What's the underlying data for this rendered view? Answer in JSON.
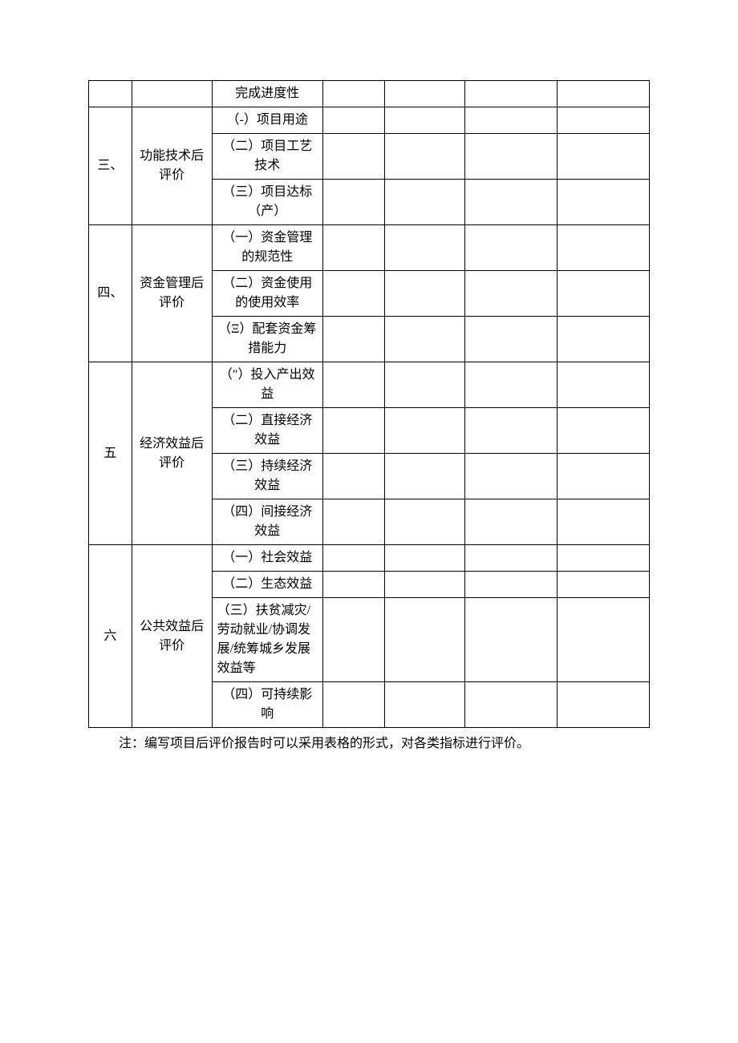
{
  "table": {
    "rows": [
      {
        "num": "",
        "category": "",
        "item": "完成进度性",
        "numRowspan": 1,
        "categoryRowspan": 1,
        "showNum": true,
        "showCategory": true
      },
      {
        "num": "三、",
        "category": "功能技术后评价",
        "item": "（-）项目用途",
        "numRowspan": 3,
        "categoryRowspan": 3,
        "showNum": true,
        "showCategory": true
      },
      {
        "item": "（二）项目工艺技术",
        "showNum": false,
        "showCategory": false
      },
      {
        "item": "（三）项目达标（产）",
        "showNum": false,
        "showCategory": false
      },
      {
        "num": "四、",
        "category": "资金管理后评价",
        "item": "（一）资金管理的规范性",
        "numRowspan": 3,
        "categoryRowspan": 3,
        "showNum": true,
        "showCategory": true
      },
      {
        "item": "（二）资金使用的使用效率",
        "showNum": false,
        "showCategory": false
      },
      {
        "item": "（Ξ）配套资金筹措能力",
        "showNum": false,
        "showCategory": false
      },
      {
        "num": "五",
        "category": "经济效益后评价",
        "item": "（″）投入产出效益",
        "numRowspan": 4,
        "categoryRowspan": 4,
        "showNum": true,
        "showCategory": true
      },
      {
        "item": "（二）直接经济效益",
        "showNum": false,
        "showCategory": false
      },
      {
        "item": "（三）持续经济效益",
        "showNum": false,
        "showCategory": false
      },
      {
        "item": "（四）间接经济效益",
        "showNum": false,
        "showCategory": false
      },
      {
        "num": "六",
        "category": "公共效益后评价",
        "item": "（一）社会效益",
        "numRowspan": 4,
        "categoryRowspan": 4,
        "showNum": true,
        "showCategory": true
      },
      {
        "item": "（二）生态效益",
        "showNum": false,
        "showCategory": false
      },
      {
        "item": "（三）扶贫减灾/劳动就业/协调发展/统筹城乡发展效益等",
        "itemAlign": "left",
        "showNum": false,
        "showCategory": false
      },
      {
        "item": "（四）可持续影响",
        "showNum": false,
        "showCategory": false
      }
    ]
  },
  "note": "注：编写项目后评价报告时可以采用表格的形式，对各类指标进行评价。"
}
